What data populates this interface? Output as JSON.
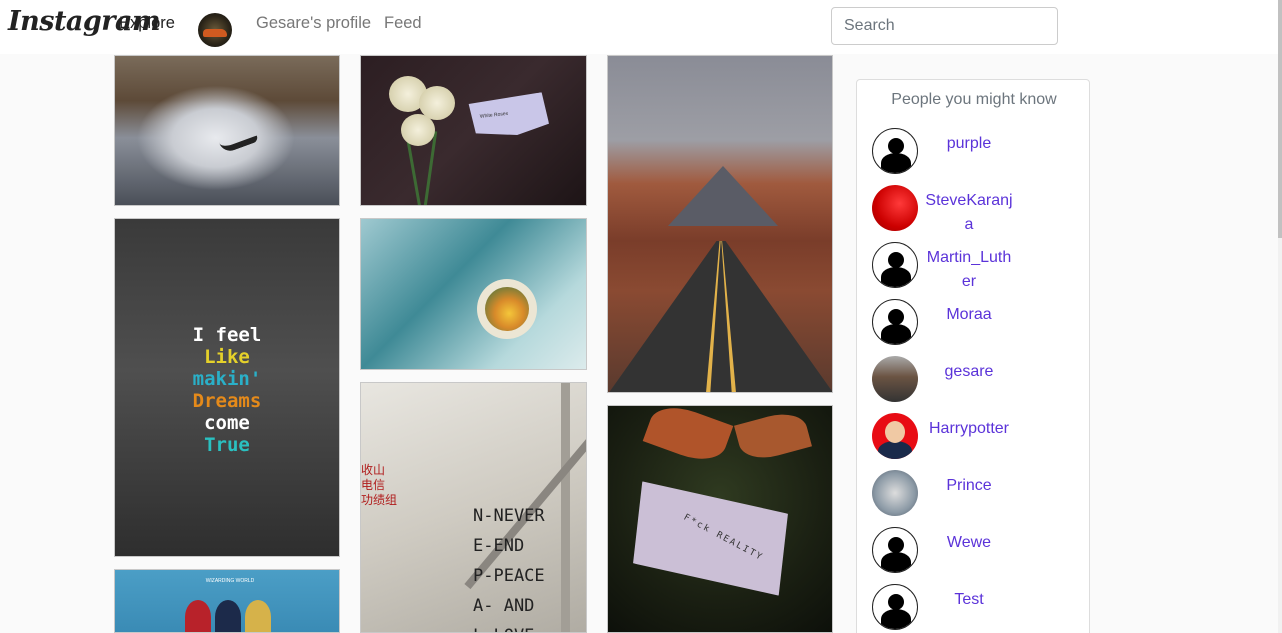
{
  "navbar": {
    "brand": "Instagram",
    "explore": "Explore",
    "profile": "Gesare's profile",
    "feed": "Feed",
    "search_placeholder": "Search"
  },
  "sidebar": {
    "title": "People you might know",
    "people": [
      {
        "name": "purple",
        "avatar": "default-avatar-icon"
      },
      {
        "name": "SteveKaranja",
        "avatar": "red-photo"
      },
      {
        "name": "Martin_Luther",
        "avatar": "default-avatar-icon"
      },
      {
        "name": "Moraa",
        "avatar": "default-avatar-icon"
      },
      {
        "name": "gesare",
        "avatar": "road-photo"
      },
      {
        "name": "Harrypotter",
        "avatar": "cartoon-photo"
      },
      {
        "name": "Prince",
        "avatar": "photo"
      },
      {
        "name": "Wewe",
        "avatar": "default-avatar-icon"
      },
      {
        "name": "Test",
        "avatar": "default-avatar-icon"
      }
    ]
  },
  "posts": {
    "dreams_text": [
      "I feel",
      "Like",
      "makin'",
      "Dreams",
      "come",
      "True"
    ],
    "wall_text": [
      "N-NEVER",
      "E-END",
      "P-PEACE",
      "A- AND",
      "L-LOVE"
    ],
    "wall_red_text": [
      "收山",
      "电信",
      "功绩组"
    ],
    "flower_note": "White Roses",
    "leaf_note": "F*ck REALITY",
    "comic_banner": "WIZARDING WORLD"
  },
  "colors": {
    "link": "#5b33d9",
    "muted": "#6c757d"
  }
}
